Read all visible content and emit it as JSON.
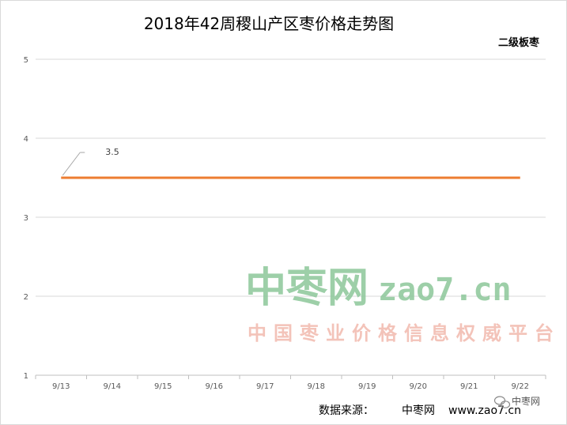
{
  "chart_data": {
    "type": "line",
    "title": "2018年42周稷山产区枣价格走势图",
    "categories": [
      "9/13",
      "9/14",
      "9/15",
      "9/16",
      "9/17",
      "9/18",
      "9/19",
      "9/20",
      "9/21",
      "9/22"
    ],
    "series": [
      {
        "name": "二级板枣",
        "values": [
          3.5,
          3.5,
          3.5,
          3.5,
          3.5,
          3.5,
          3.5,
          3.5,
          3.5,
          3.5
        ],
        "color": "#ED7D31"
      }
    ],
    "data_labels": [
      {
        "index": 0,
        "text": "3.5"
      }
    ],
    "ylim": [
      1,
      5
    ],
    "yticks": [
      "1",
      "2",
      "3",
      "4",
      "5"
    ],
    "grid": true,
    "legend_position": "top-right"
  },
  "watermark": {
    "brand": "中枣网",
    "url": "zao7.cn",
    "slogan": "中国枣业价格信息权威平台",
    "brand_color": "#8cc79a",
    "slogan_color": "#f2b9ad"
  },
  "footer": {
    "source_label": "数据来源：",
    "source_name": "中枣网",
    "source_url": "www.zao7.cn"
  },
  "badge": {
    "text": "中枣网",
    "icon": "wechat-icon"
  }
}
